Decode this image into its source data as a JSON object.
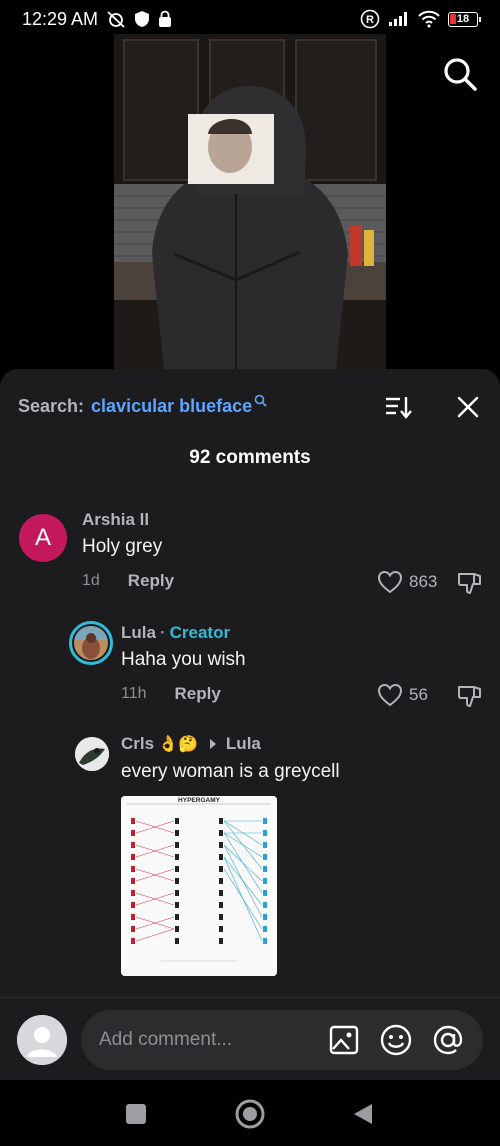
{
  "status_bar": {
    "time": "12:29 AM",
    "battery": "18"
  },
  "search": {
    "prefix": "Search:",
    "term": "clavicular blueface"
  },
  "comments_count": "92 comments",
  "comments": [
    {
      "username": "Arshia ll",
      "avatar_letter": "A",
      "text": "Holy grey",
      "age": "1d",
      "reply_label": "Reply",
      "likes": "863"
    },
    {
      "username": "Lula",
      "badge": "Creator",
      "separator": "·",
      "text": "Haha you wish",
      "age": "11h",
      "reply_label": "Reply",
      "likes": "56"
    },
    {
      "username": "Crls",
      "emojis": "👌🤔",
      "reply_to": "Lula",
      "text": "every woman is a greycell",
      "image_title": "HYPERGAMY"
    }
  ],
  "composer": {
    "placeholder": "Add comment..."
  },
  "colors": {
    "sheet_bg": "#1c1c1e",
    "accent_search": "#5ea5ff",
    "creator": "#2fbcd9",
    "avatar_a": "#c4185c"
  }
}
